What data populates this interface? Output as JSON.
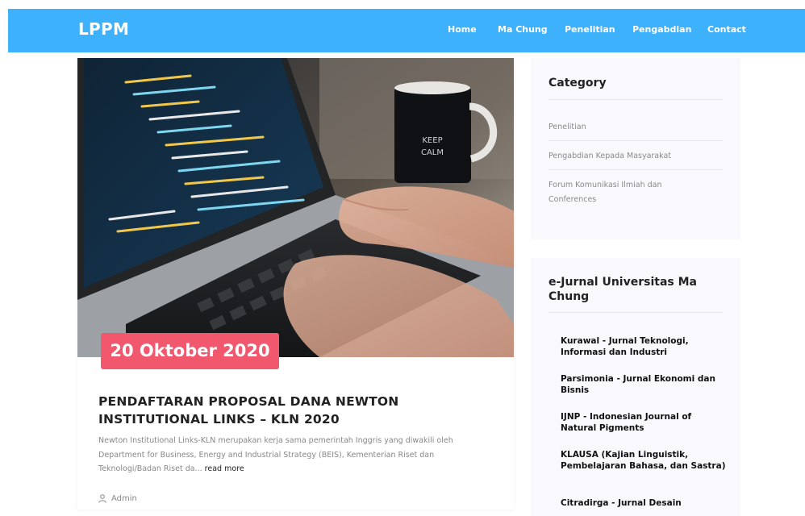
{
  "nav": {
    "brand": "LPPM",
    "links": [
      "Home",
      "Ma Chung",
      "Penelitian",
      "Pengabdian",
      "Contact"
    ]
  },
  "post": {
    "date": "20 Oktober 2020",
    "title": "PENDAFTARAN PROPOSAL DANA NEWTON INSTITUTIONAL LINKS – KLN 2020",
    "excerpt": "Newton Institutional Links-KLN merupakan kerja sama pemerintah Inggris yang diwakili oleh Department for Business, Energy and Industrial Strategy (BEIS), Kementerian Riset dan Teknologi/Badan Riset da...",
    "read_more": "read more",
    "author": "Admin"
  },
  "sidebar": {
    "category": {
      "title": "Category",
      "items": [
        "Penelitian",
        "Pengabdian Kepada Masyarakat",
        "Forum Komunikasi Ilmiah dan Conferences"
      ]
    },
    "jurnal": {
      "title": "e-Jurnal Universitas Ma Chung",
      "items": [
        "Kurawal - Jurnal Teknologi, Informasi dan Industri",
        "Parsimonia - Jurnal Ekonomi dan Bisnis",
        "IJNP - Indonesian Journal of Natural Pigments",
        "KLAUSA (Kajian Linguistik, Pembelajaran Bahasa, dan Sastra)",
        "Citradirga - Jurnal Desain"
      ]
    }
  },
  "colors": {
    "nav_bg": "#3db1fb",
    "date_badge": "#f1586d",
    "sidebar_bg": "#f8f8fd"
  }
}
